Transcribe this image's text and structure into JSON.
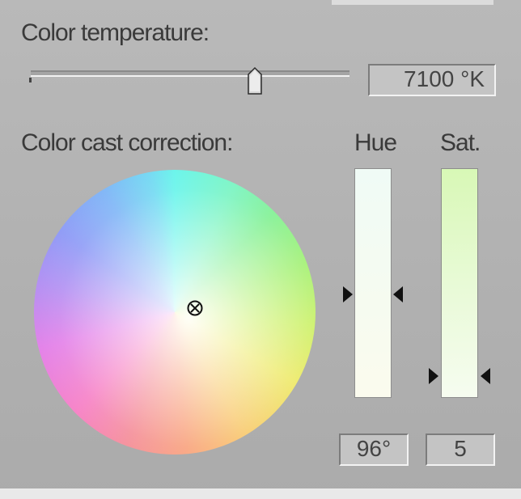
{
  "temperature": {
    "label": "Color temperature:",
    "value_text": "7100 °K"
  },
  "cast": {
    "label": "Color cast correction:"
  },
  "hue": {
    "label": "Hue",
    "value_text": "96°"
  },
  "sat": {
    "label": "Sat.",
    "value_text": "5"
  },
  "icons": {
    "slider_thumb": "slider-thumb-icon",
    "wheel_cursor": "crosshair-circle-icon",
    "arrow_right": "triangle-right-icon",
    "arrow_left": "triangle-left-icon"
  },
  "colors": {
    "panel_background": "#b4b4b4",
    "text": "#3a3a3a",
    "field_background": "#c4c4c4"
  }
}
